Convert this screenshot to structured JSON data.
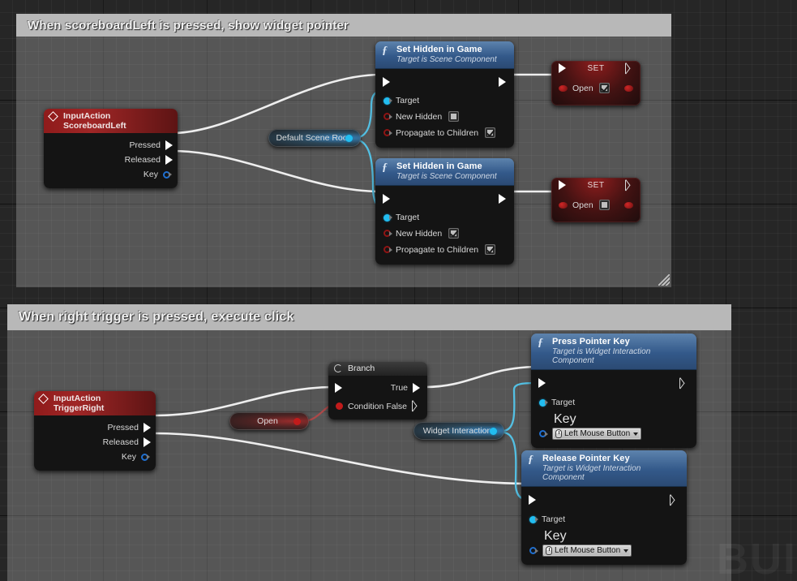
{
  "editor": {
    "name": "blueprint-event-graph",
    "watermark": "BUI"
  },
  "comments": [
    {
      "title": "When scoreboardLeft is pressed, show widget pointer"
    },
    {
      "title": "When right trigger is pressed, execute click"
    }
  ],
  "nodes": {
    "input_scoreboard_left": {
      "title": "InputAction ScoreboardLeft",
      "pins": [
        "Pressed",
        "Released",
        "Key"
      ]
    },
    "input_trigger_right": {
      "title": "InputAction TriggerRight",
      "pins": [
        "Pressed",
        "Released",
        "Key"
      ]
    },
    "set_hidden_1": {
      "title": "Set Hidden in Game",
      "subtitle": "Target is Scene Component",
      "target_label": "Target",
      "new_hidden_label": "New Hidden",
      "new_hidden_value": false,
      "propagate_label": "Propagate to Children",
      "propagate_value": true
    },
    "set_hidden_2": {
      "title": "Set Hidden in Game",
      "subtitle": "Target is Scene Component",
      "target_label": "Target",
      "new_hidden_label": "New Hidden",
      "new_hidden_value": true,
      "propagate_label": "Propagate to Children",
      "propagate_value": true
    },
    "set_open_1": {
      "title": "SET",
      "var_label": "Open",
      "var_value": true
    },
    "set_open_2": {
      "title": "SET",
      "var_label": "Open",
      "var_value": false
    },
    "default_scene_root": {
      "label": "Default Scene Root"
    },
    "open_var": {
      "label": "Open"
    },
    "widget_interaction_var": {
      "label": "Widget Interaction"
    },
    "branch": {
      "title": "Branch",
      "condition_label": "Condition",
      "true_label": "True",
      "false_label": "False"
    },
    "press_pointer_key": {
      "title": "Press Pointer Key",
      "subtitle": "Target is Widget Interaction Component",
      "target_label": "Target",
      "key_label": "Key",
      "key_value": "Left Mouse Button"
    },
    "release_pointer_key": {
      "title": "Release Pointer Key",
      "subtitle": "Target is Widget Interaction Component",
      "target_label": "Target",
      "key_label": "Key",
      "key_value": "Left Mouse Button"
    }
  },
  "colors": {
    "exec_wire": "#ffffff",
    "object_wire": "#22bdf0",
    "bool_wire": "#a01414",
    "function_node_header": "#33598a",
    "event_node_header": "#a02626",
    "comment_header": "#b8b8b8"
  }
}
